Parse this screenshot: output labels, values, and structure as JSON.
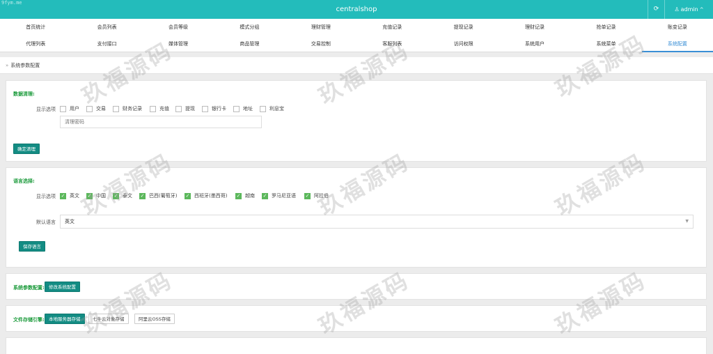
{
  "header": {
    "corner_mark": "9fym.me",
    "title": "centralshop",
    "refresh_icon": "⟳",
    "user_icon": "♙",
    "user_name": "admin",
    "user_chevron": "^"
  },
  "nav": {
    "row1": [
      "首页统计",
      "会员列表",
      "会员等级",
      "模式分组",
      "理财管理",
      "充值记录",
      "提现记录",
      "理财记录",
      "抢单记录",
      "账变记录"
    ],
    "row2": [
      "代理列表",
      "支付接口",
      "媒体管理",
      "商品管理",
      "交易控制",
      "客服列表",
      "访问权限",
      "系统用户",
      "系统菜单",
      "系统配置"
    ],
    "active": "系统配置"
  },
  "breadcrumb": {
    "arrow": "»",
    "text": "系统参数配置"
  },
  "data_clean": {
    "title": "数据清理:",
    "option_label": "显示选项",
    "options": [
      "用户",
      "交易",
      "财务记录",
      "充值",
      "提现",
      "银行卡",
      "地址",
      "利息宝"
    ],
    "password_placeholder": "清理密码",
    "confirm_button": "确定清理"
  },
  "language": {
    "title": "语言选择:",
    "option_label": "显示选项",
    "options": [
      "英文",
      "中国",
      "泰文",
      "巴西(葡萄牙)",
      "西班牙(墨西哥)",
      "越南",
      "罗马尼亚语",
      "阿拉伯"
    ],
    "default_label": "默认语言",
    "default_value": "英文",
    "save_button": "保存语言"
  },
  "system_params": {
    "title": "系统参数配置:",
    "edit_button": "修改系统配置"
  },
  "storage": {
    "title": "文件存储引擎:",
    "buttons": [
      "本地服务器存储",
      "七牛云对象存储",
      "阿里云OSS存储"
    ],
    "active_index": 0
  },
  "watermark_text": "玖福源码"
}
